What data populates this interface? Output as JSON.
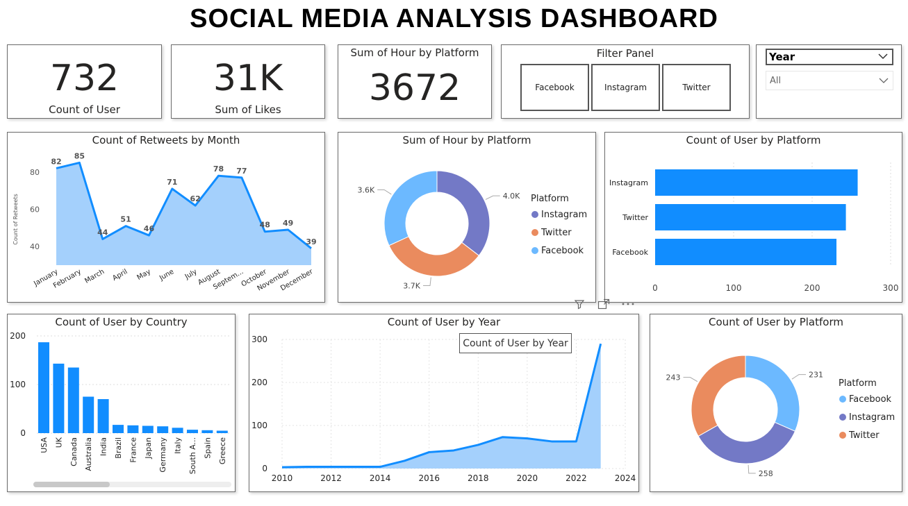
{
  "title": "SOCIAL MEDIA ANALYSIS DASHBOARD",
  "kpis": {
    "users": {
      "value": "732",
      "label": "Count of User"
    },
    "likes": {
      "value": "31K",
      "label": "Sum of Likes"
    },
    "hours": {
      "value": "3672",
      "label": "Sum of Hour by Platform"
    }
  },
  "filter_panel": {
    "title": "Filter Panel",
    "buttons": [
      "Facebook",
      "Instagram",
      "Twitter"
    ]
  },
  "year_slicer": {
    "label": "Year",
    "selected": "All"
  },
  "colors": {
    "blue": "#118DFF",
    "area": "#A4D0FC",
    "instagram": "#7379C6",
    "twitter": "#EA8B5E",
    "facebook": "#6CB9FF"
  },
  "icons": [
    "filter-icon",
    "focus-mode-icon",
    "more-options-icon"
  ],
  "tooltip": "Count of User by Year",
  "chart_data": [
    {
      "id": "retweets_by_month",
      "type": "area",
      "title": "Count of Retweets by Month",
      "ylabel": "Count of Retweets",
      "xlabel": "",
      "categories": [
        "January",
        "February",
        "March",
        "April",
        "May",
        "June",
        "July",
        "August",
        "Septem...",
        "October",
        "November",
        "December"
      ],
      "values": [
        82,
        85,
        44,
        51,
        46,
        71,
        62,
        78,
        77,
        48,
        49,
        39
      ],
      "yticks": [
        40,
        60,
        80
      ],
      "ylim": [
        30,
        90
      ],
      "grid": false
    },
    {
      "id": "hour_by_platform",
      "type": "pie",
      "title": "Sum of Hour by Platform",
      "legend_title": "Platform",
      "labels": [
        "Instagram",
        "Twitter",
        "Facebook"
      ],
      "values": [
        4.0,
        3.7,
        3.6
      ],
      "data_labels": [
        "4.0K",
        "3.7K",
        "3.6K"
      ],
      "legend": "right"
    },
    {
      "id": "users_by_platform_bar",
      "type": "bar",
      "orientation": "horizontal",
      "title": "Count of User by Platform",
      "categories": [
        "Instagram",
        "Twitter",
        "Facebook"
      ],
      "values": [
        258,
        243,
        231
      ],
      "xticks": [
        0,
        100,
        200,
        300
      ],
      "xlim": [
        0,
        300
      ],
      "grid": true
    },
    {
      "id": "users_by_country",
      "type": "bar",
      "title": "Count of User by Country",
      "categories": [
        "USA",
        "UK",
        "Canada",
        "Australia",
        "India",
        "Brazil",
        "France",
        "Japan",
        "Germany",
        "Italy",
        "South A...",
        "Spain",
        "Greece"
      ],
      "values": [
        187,
        143,
        135,
        75,
        70,
        17,
        16,
        15,
        14,
        11,
        7,
        6,
        5
      ],
      "yticks": [
        0,
        100,
        200
      ],
      "ylim": [
        0,
        210
      ],
      "grid": true
    },
    {
      "id": "users_by_year",
      "type": "area",
      "title": "Count of User by Year",
      "x": [
        2010,
        2011,
        2012,
        2013,
        2014,
        2015,
        2016,
        2017,
        2018,
        2019,
        2020,
        2021,
        2022,
        2023
      ],
      "values": [
        3,
        4,
        4,
        4,
        4,
        18,
        38,
        42,
        55,
        73,
        70,
        63,
        63,
        290
      ],
      "xticks": [
        2010,
        2012,
        2014,
        2016,
        2018,
        2020,
        2022,
        2024
      ],
      "yticks": [
        0,
        100,
        200,
        300
      ],
      "xlim": [
        2010,
        2024
      ],
      "ylim": [
        0,
        300
      ],
      "grid": true
    },
    {
      "id": "users_by_platform_pie",
      "type": "pie",
      "title": "Count of User by Platform",
      "legend_title": "Platform",
      "labels": [
        "Facebook",
        "Instagram",
        "Twitter"
      ],
      "values": [
        231,
        258,
        243
      ],
      "data_labels": [
        "231",
        "258",
        "243"
      ],
      "legend": "right"
    }
  ]
}
